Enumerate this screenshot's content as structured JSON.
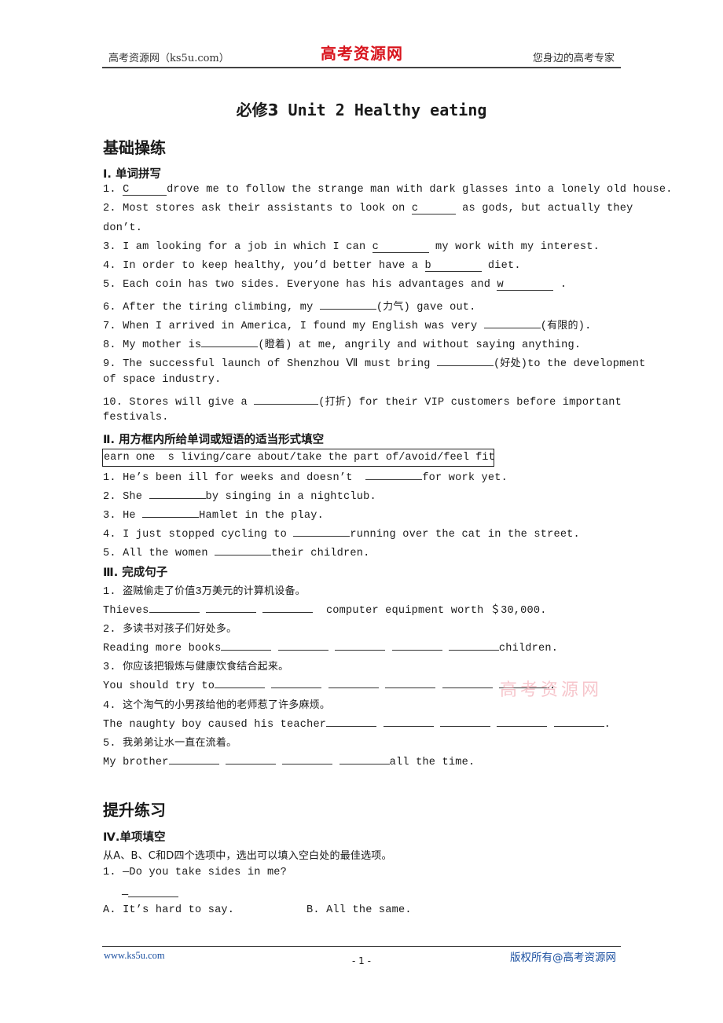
{
  "header": {
    "left": "高考资源网（ks5u.com）",
    "logo": "高考资源网",
    "right": "您身边的高考专家"
  },
  "title": {
    "cn": "必修3",
    "en": " Unit  2  Healthy eating"
  },
  "section_basic": "基础操练",
  "part1": {
    "heading": "Ⅰ. 单词拼写",
    "items": [
      {
        "num": "1.",
        "pre": "",
        "hint": "C",
        "post": "drove me to follow the strange man with dark glasses into a lonely old house."
      },
      {
        "num": "2.",
        "pre": " Most stores ask their assistants to look on ",
        "hint": "c",
        "post": " as gods, but actually they"
      },
      {
        "num": "",
        "pre": "don’t.",
        "hint": "",
        "post": ""
      },
      {
        "num": "3.",
        "pre": " I am looking for a job in which I can ",
        "hint": "c",
        "post": " my work with my interest."
      },
      {
        "num": "4.",
        "pre": " In order to keep healthy, you’d better have a ",
        "hint": "b",
        "post": " diet."
      },
      {
        "num": "5.",
        "pre": " Each coin has two sides. Everyone has his advantages and ",
        "hint": "w",
        "post": " ."
      },
      {
        "num": "6.",
        "pre": " After the tiring climbing, my ",
        "hint": "",
        "post": "(力气) gave out."
      },
      {
        "num": "7.",
        "pre": " When I arrived in America, I found my English was very ",
        "hint": "",
        "post": "(有限的)."
      },
      {
        "num": "8.",
        "pre": " My mother is",
        "hint": "",
        "post": "(瞪着) at me, angrily and without saying anything."
      },
      {
        "num": "9.",
        "pre": " The successful launch of Shenzhou Ⅶ must bring ",
        "hint": "",
        "post": "(好处)to the development"
      },
      {
        "num": "",
        "pre": "of space industry.",
        "hint": "",
        "post": ""
      },
      {
        "num": "10.",
        "pre": " Stores will give a ",
        "hint": "",
        "post": "(打折) for their VIP customers before important"
      },
      {
        "num": "",
        "pre": "festivals.",
        "hint": "",
        "post": ""
      }
    ]
  },
  "part2": {
    "heading": "Ⅱ. 用方框内所给单词或短语的适当形式填空",
    "word_box": "earn one  s living/care about/take the part of/avoid/feel fit",
    "items": [
      {
        "num": "1.",
        "pre": " He’s been ill for weeks and doesn’t  ",
        "post": "for work yet."
      },
      {
        "num": "2.",
        "pre": " She ",
        "post": "by singing in a nightclub."
      },
      {
        "num": "3.",
        "pre": " He ",
        "post": "Hamlet in the play."
      },
      {
        "num": "4.",
        "pre": " I just stopped cycling to ",
        "post": "running over the cat in the street."
      },
      {
        "num": "5.",
        "pre": " All the women ",
        "post": "their children."
      }
    ]
  },
  "part3": {
    "heading": "Ⅲ. 完成句子",
    "items": [
      {
        "cn": "1. 盗贼偷走了价值3万美元的计算机设备。",
        "en_pre": "Thieves",
        "blanks": 3,
        "en_post": "  computer equipment worth ＄30,000."
      },
      {
        "cn": "2. 多读书对孩子们好处多。",
        "en_pre": "Reading more books",
        "blanks": 5,
        "en_post": "children."
      },
      {
        "cn": "3. 你应该把锻炼与健康饮食结合起来。",
        "en_pre": "You should try to",
        "blanks": 6,
        "en_post": "."
      },
      {
        "cn": "4. 这个淘气的小男孩给他的老师惹了许多麻烦。",
        "en_pre": "The naughty boy caused his teacher",
        "blanks": 5,
        "en_post": "."
      },
      {
        "cn": "5. 我弟弟让水一直在流着。",
        "en_pre": "My brother",
        "blanks": 4,
        "en_post": "all the time."
      }
    ]
  },
  "section_advanced": "提升练习",
  "part4": {
    "heading": "Ⅳ.单项填空",
    "instruction": "从A、B、C和D四个选项中，选出可以填入空白处的最佳选项。",
    "q1": "1. —Do you take sides in me?",
    "q1_answer_dash": "—",
    "option_a": "A. It’s hard to say.",
    "option_b": "B. All the same."
  },
  "watermark": "高考资源网",
  "footer": {
    "left": "www.ks5u.com",
    "page": "- 1 -",
    "right": "版权所有@高考资源网"
  }
}
